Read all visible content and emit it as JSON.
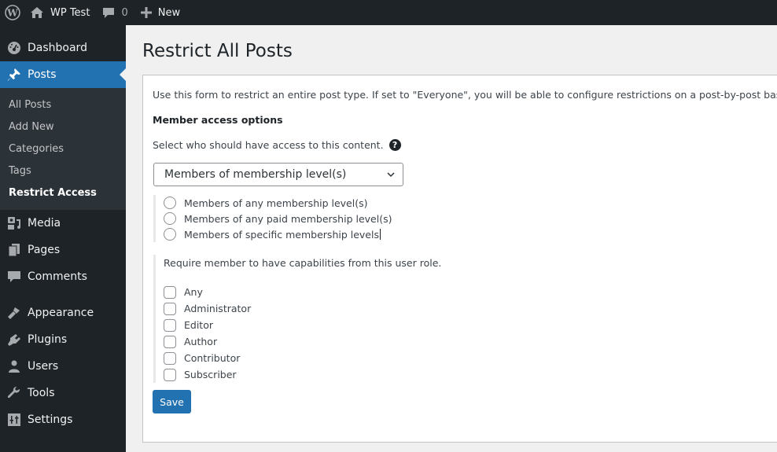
{
  "adminbar": {
    "site_name": "WP Test",
    "comments_count": "0",
    "new_label": "New"
  },
  "sidebar": {
    "items_top": [
      {
        "label": "Dashboard",
        "icon": "dashboard-icon"
      },
      {
        "label": "Posts",
        "icon": "pin-icon",
        "current": true
      }
    ],
    "posts_submenu": [
      {
        "label": "All Posts"
      },
      {
        "label": "Add New"
      },
      {
        "label": "Categories"
      },
      {
        "label": "Tags"
      },
      {
        "label": "Restrict Access",
        "current": true
      }
    ],
    "items_mid": [
      {
        "label": "Media",
        "icon": "media-icon"
      },
      {
        "label": "Pages",
        "icon": "pages-icon"
      },
      {
        "label": "Comments",
        "icon": "comments-icon"
      }
    ],
    "items_bottom": [
      {
        "label": "Appearance",
        "icon": "paintbrush-icon"
      },
      {
        "label": "Plugins",
        "icon": "plugin-icon"
      },
      {
        "label": "Users",
        "icon": "users-icon"
      },
      {
        "label": "Tools",
        "icon": "wrench-icon"
      },
      {
        "label": "Settings",
        "icon": "settings-icon"
      }
    ]
  },
  "page": {
    "title": "Restrict All Posts",
    "intro": "Use this form to restrict an entire post type. If set to \"Everyone\", you will be able to configure restrictions on a post-by-post basis.",
    "section_heading": "Member access options",
    "select_label": "Select who should have access to this content.",
    "help_glyph": "?",
    "access_select_value": "Members of membership level(s)",
    "radio_options": [
      {
        "label": "Members of any membership level(s)",
        "checked": false
      },
      {
        "label": "Members of any paid membership level(s)",
        "checked": false
      },
      {
        "label": "Members of specific membership levels",
        "checked": false
      }
    ],
    "capabilities_label": "Require member to have capabilities from this user role.",
    "roles": [
      {
        "label": "Any",
        "checked": false
      },
      {
        "label": "Administrator",
        "checked": false
      },
      {
        "label": "Editor",
        "checked": false
      },
      {
        "label": "Author",
        "checked": false
      },
      {
        "label": "Contributor",
        "checked": false
      },
      {
        "label": "Subscriber",
        "checked": false
      }
    ],
    "save_label": "Save"
  },
  "colors": {
    "accent": "#2271b1",
    "adminbar_bg": "#1d2327",
    "submenu_bg": "#2c3338",
    "page_bg": "#f0f0f1"
  }
}
